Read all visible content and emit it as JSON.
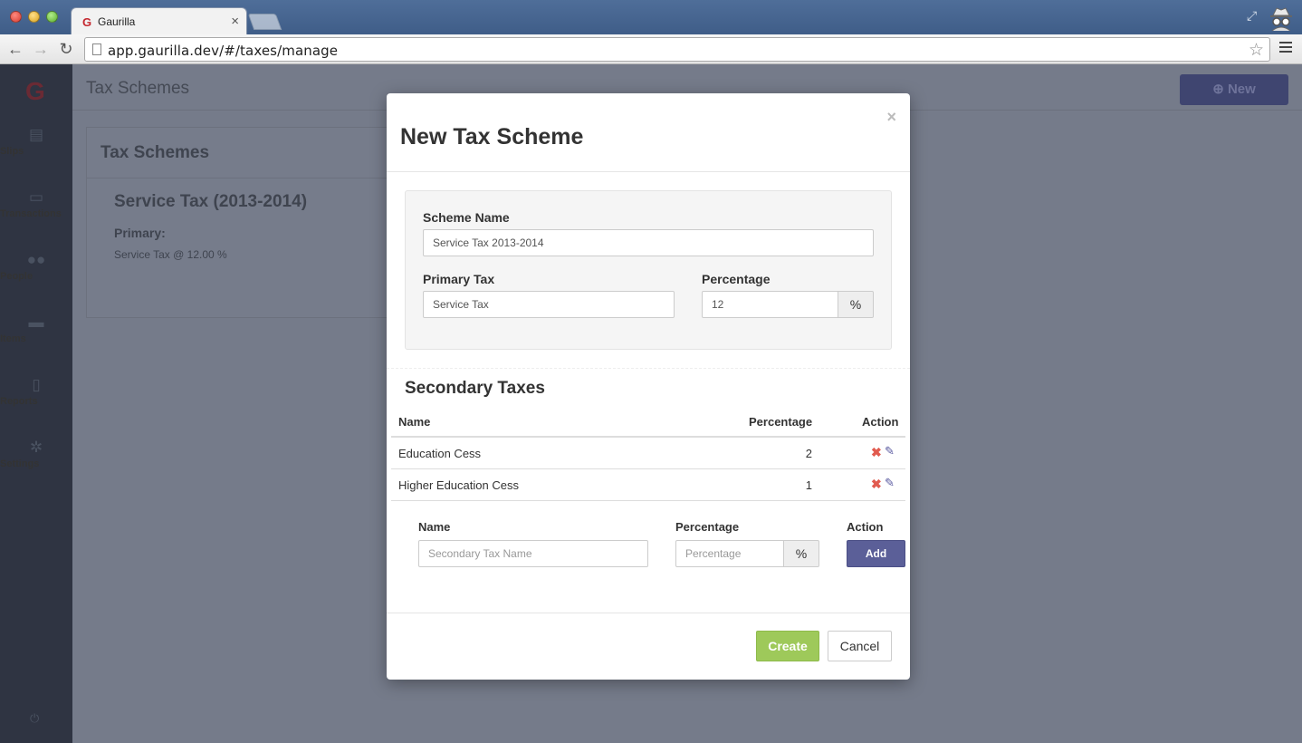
{
  "browser": {
    "tab_title": "Gaurilla",
    "tab_favicon": "G",
    "url": "app.gaurilla.dev/#/taxes/manage"
  },
  "sidebar": {
    "items": [
      {
        "label": "Slips",
        "icon": "document-icon"
      },
      {
        "label": "Transactions",
        "icon": "money-icon"
      },
      {
        "label": "People",
        "icon": "users-icon"
      },
      {
        "label": "Items",
        "icon": "cart-icon"
      },
      {
        "label": "Reports",
        "icon": "report-icon"
      },
      {
        "label": "Settings",
        "icon": "gears-icon"
      }
    ]
  },
  "header": {
    "title": "Tax Schemes",
    "new_button": "New"
  },
  "panel": {
    "title": "Tax Schemes",
    "scheme_title": "Service Tax (2013-2014)",
    "primary_label": "Primary:",
    "primary_detail": "Service Tax @ 12.00 %"
  },
  "modal": {
    "title": "New Tax Scheme",
    "close": "×",
    "scheme_name_label": "Scheme Name",
    "scheme_name_value": "Service Tax 2013-2014",
    "primary_tax_label": "Primary Tax",
    "primary_tax_value": "Service Tax",
    "percentage_label": "Percentage",
    "percentage_value": "12",
    "percent_symbol": "%",
    "secondary_title": "Secondary Taxes",
    "table": {
      "headers": {
        "name": "Name",
        "percentage": "Percentage",
        "action": "Action"
      },
      "rows": [
        {
          "name": "Education Cess",
          "percentage": "2"
        },
        {
          "name": "Higher Education Cess",
          "percentage": "1"
        }
      ]
    },
    "add_form": {
      "name_label": "Name",
      "name_placeholder": "Secondary Tax Name",
      "percentage_label": "Percentage",
      "percentage_placeholder": "Percentage",
      "action_label": "Action",
      "add_button": "Add"
    },
    "create_button": "Create",
    "cancel_button": "Cancel"
  },
  "colors": {
    "primary": "#5b5f98",
    "success": "#9ec95a",
    "danger": "#e15b4f"
  }
}
